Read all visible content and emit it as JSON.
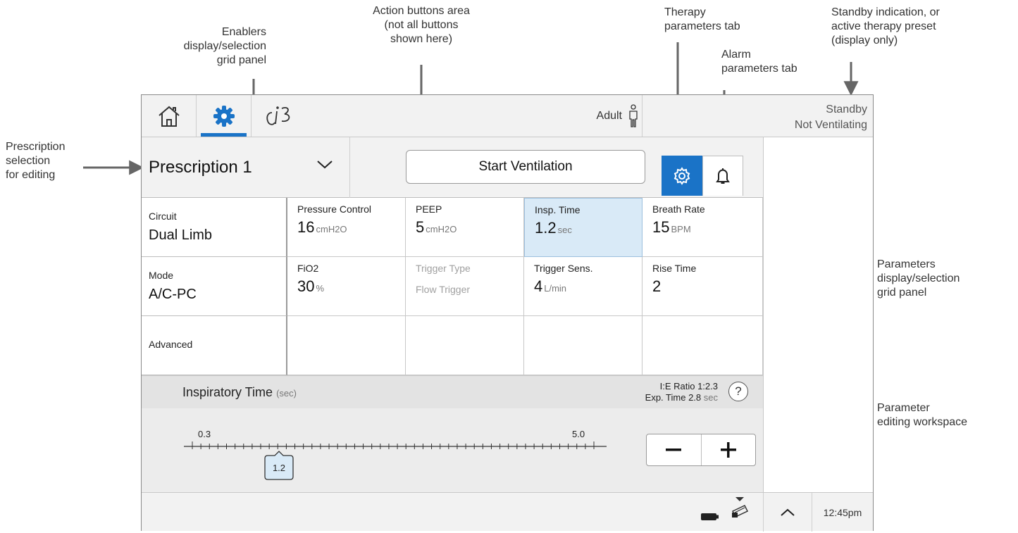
{
  "callouts": {
    "enablers": [
      "Enablers",
      "display/selection",
      "grid panel"
    ],
    "actions": [
      "Action buttons area",
      "(not all buttons",
      "shown here)"
    ],
    "therapy_tab": [
      "Therapy",
      "parameters tab"
    ],
    "alarm_tab": [
      "Alarm",
      "parameters tab"
    ],
    "standby": [
      "Standby indication, or",
      "active therapy preset",
      "(display only)"
    ],
    "prescription": [
      "Prescription",
      "selection",
      "for editing"
    ],
    "params_grid": [
      "Parameters",
      "display/selection",
      "grid panel"
    ],
    "workspace": [
      "Parameter",
      "editing workspace"
    ]
  },
  "topbar": {
    "patient_type": "Adult",
    "status_line1": "Standby",
    "status_line2": "Not Ventilating"
  },
  "prescription": {
    "selected": "Prescription 1"
  },
  "actions": {
    "start_label": "Start Ventilation"
  },
  "enablers": [
    {
      "label": "Circuit",
      "value": "Dual Limb"
    },
    {
      "label": "Mode",
      "value": "A/C-PC"
    },
    {
      "label": "Advanced",
      "value": ""
    }
  ],
  "params": {
    "pressure_control": {
      "label": "Pressure Control",
      "value": "16",
      "unit": "cmH2O"
    },
    "peep": {
      "label": "PEEP",
      "value": "5",
      "unit": "cmH2O"
    },
    "insp_time": {
      "label": "Insp. Time",
      "value": "1.2",
      "unit": "sec"
    },
    "breath_rate": {
      "label": "Breath Rate",
      "value": "15",
      "unit": "BPM"
    },
    "fio2": {
      "label": "FiO2",
      "value": "30",
      "unit": "%"
    },
    "trigger_type": {
      "label": "Trigger Type",
      "value": "Flow Trigger"
    },
    "trigger_sens": {
      "label": "Trigger Sens.",
      "value": "4",
      "unit": "L/min"
    },
    "rise_time": {
      "label": "Rise Time",
      "value": "2"
    }
  },
  "workspace": {
    "title": "Inspiratory Time",
    "title_unit": "(sec)",
    "ie_ratio": "I:E Ratio 1:2.3",
    "exp_time": "Exp. Time 2.8",
    "exp_unit": "sec",
    "help": "?",
    "slider_min": "0.3",
    "slider_max": "5.0",
    "slider_value": "1.2"
  },
  "bottombar": {
    "time": "12:45pm"
  },
  "colors": {
    "accent": "#1a73c7",
    "selected_cell": "#d9eaf7"
  },
  "icons": [
    "home-icon",
    "settings-gear-icon",
    "tools-icon",
    "adult-person-icon",
    "chevron-down-icon",
    "gear-icon",
    "bell-icon",
    "help-icon",
    "minus-icon",
    "plus-icon",
    "battery-icon",
    "card-insert-icon",
    "chevron-up-icon"
  ]
}
